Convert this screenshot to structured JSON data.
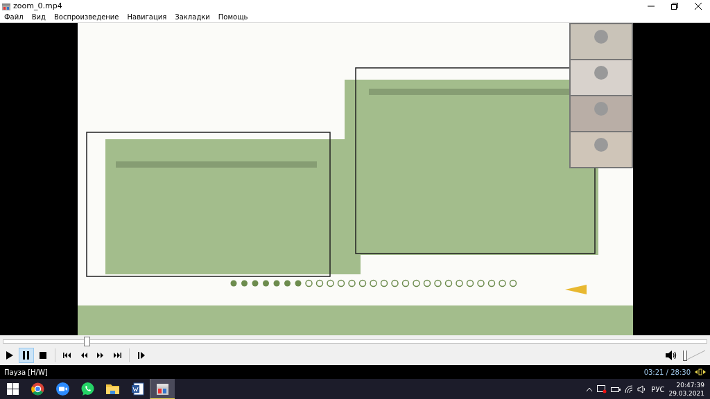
{
  "window": {
    "title": "zoom_0.mp4"
  },
  "menu": [
    "Файл",
    "Вид",
    "Воспроизведение",
    "Навигация",
    "Закладки",
    "Помощь"
  ],
  "seek": {
    "level": 0.118
  },
  "controls": [
    {
      "kind": "play",
      "selected": false
    },
    {
      "kind": "pause",
      "selected": true
    },
    {
      "kind": "stop",
      "selected": false
    },
    {
      "kind": "sep"
    },
    {
      "kind": "prev",
      "selected": false
    },
    {
      "kind": "rewind",
      "selected": false
    },
    {
      "kind": "forward",
      "selected": false
    },
    {
      "kind": "next",
      "selected": false
    },
    {
      "kind": "sep"
    },
    {
      "kind": "frame",
      "selected": false
    }
  ],
  "volume": {
    "level": 0.0
  },
  "status_bar": {
    "state": "Пауза [H/W]",
    "time": "03:21 / 28:30"
  },
  "taskbar": {
    "apps": [
      {
        "kind": "start",
        "selected": false
      },
      {
        "kind": "browser",
        "selected": false
      },
      {
        "kind": "video",
        "selected": false
      },
      {
        "kind": "chat",
        "selected": false
      },
      {
        "kind": "folder",
        "selected": false
      },
      {
        "kind": "document",
        "selected": false
      },
      {
        "kind": "player",
        "selected": true
      }
    ],
    "tray": {
      "language": "РУС",
      "time": "20:47:39",
      "date": "29.03.2021"
    }
  }
}
